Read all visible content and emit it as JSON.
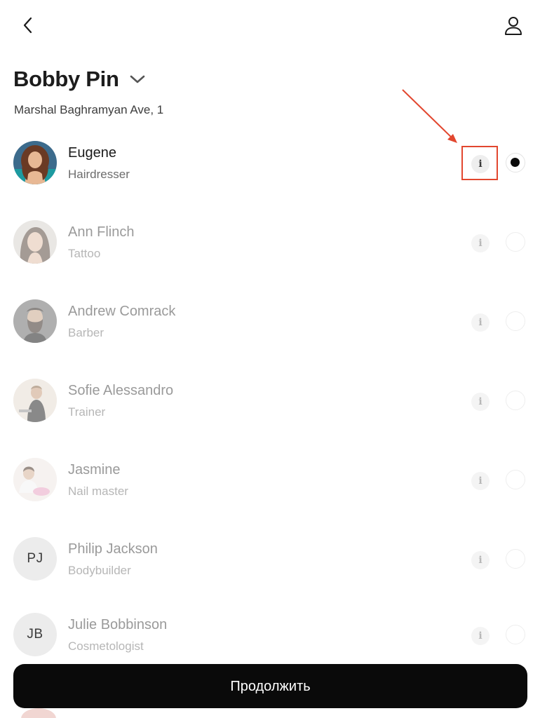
{
  "salon": {
    "name": "Bobby Pin",
    "address": "Marshal Baghramyan Ave, 1"
  },
  "staff": [
    {
      "name": "Eugene",
      "role": "Hairdresser",
      "selected": true,
      "avatar_type": "photo",
      "icon": "person-photo-curly-hair"
    },
    {
      "name": "Ann Flinch",
      "role": "Tattoo",
      "selected": false,
      "avatar_type": "photo",
      "icon": "person-photo-dark-hair"
    },
    {
      "name": "Andrew Comrack",
      "role": "Barber",
      "selected": false,
      "avatar_type": "photo",
      "icon": "person-photo-bearded"
    },
    {
      "name": "Sofie Alessandro",
      "role": "Trainer",
      "selected": false,
      "avatar_type": "photo",
      "icon": "person-photo-fitness"
    },
    {
      "name": "Jasmine",
      "role": "Nail master",
      "selected": false,
      "avatar_type": "photo",
      "icon": "person-photo-nails"
    },
    {
      "name": "Philip Jackson",
      "role": "Bodybuilder",
      "selected": false,
      "avatar_type": "initials",
      "initials": "PJ"
    },
    {
      "name": "Julie Bobbinson",
      "role": "Cosmetologist",
      "selected": false,
      "avatar_type": "initials",
      "initials": "JB"
    }
  ],
  "info_glyph": "i",
  "continue_label": "Продолжить",
  "colors": {
    "primary": "#0a0a0a",
    "annotation": "#e2472f",
    "muted_text": "#9a9a9a"
  }
}
